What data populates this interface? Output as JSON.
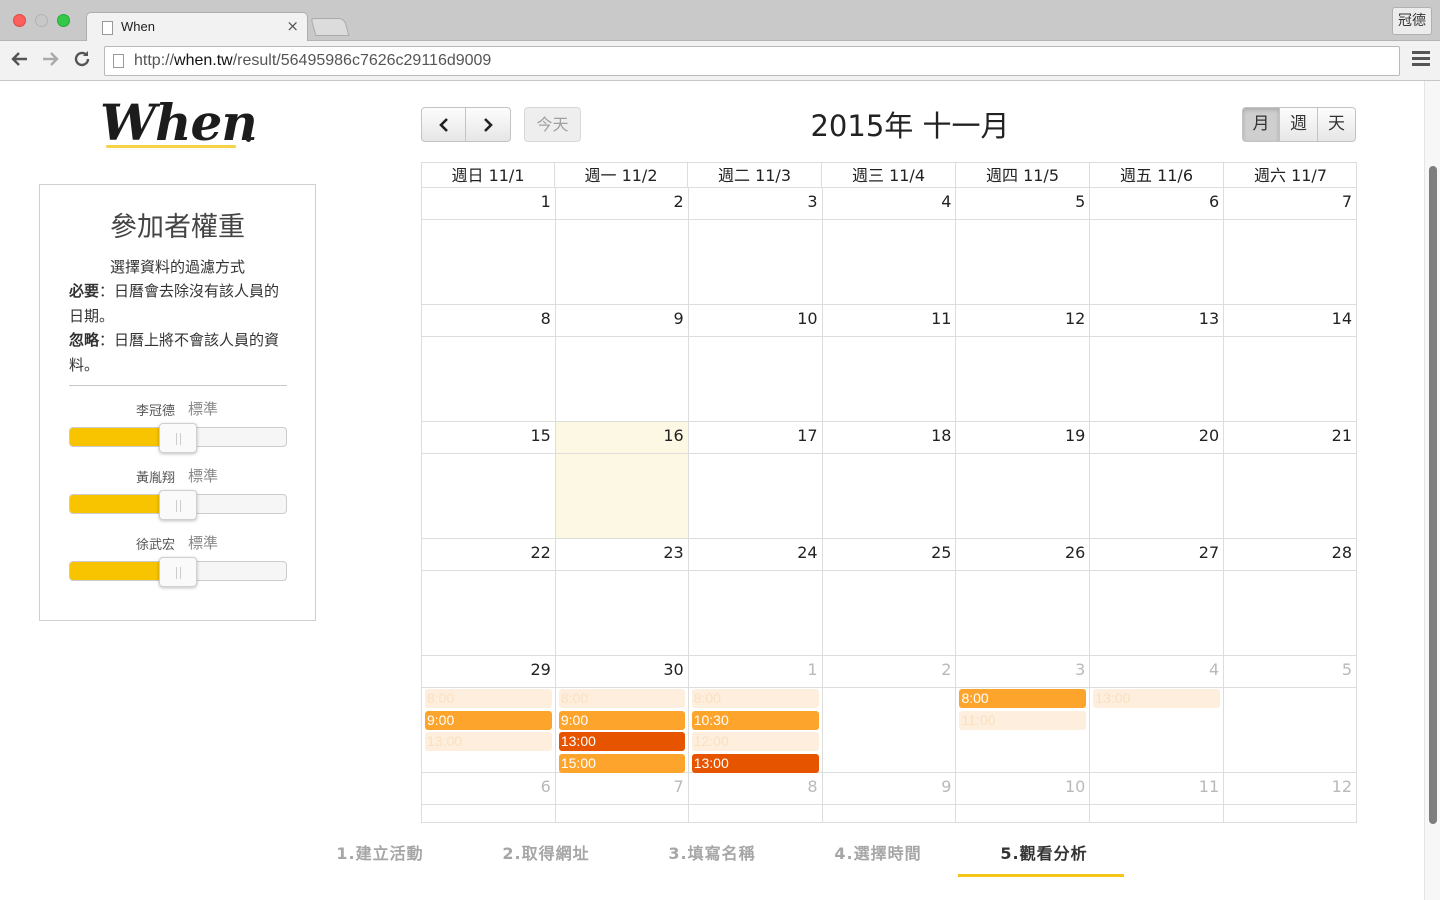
{
  "browser": {
    "tab_title": "When",
    "tab_close": "×",
    "profile": "冠德",
    "url_prefix": "http://",
    "url_host": "when.tw",
    "url_path": "/result/56495986c7626c29116d9009"
  },
  "logo": "When",
  "weights_panel": {
    "title": "參加者權重",
    "subtitle": "選擇資料的過濾方式",
    "required_label": "必要",
    "required_text": "：日曆會去除沒有該人員的日期。",
    "ignore_label": "忽略",
    "ignore_text": "：日曆上將不會該人員的資料。",
    "participants": [
      {
        "name": "李冠德",
        "level_label": "標準",
        "level": 0.5
      },
      {
        "name": "黃胤翔",
        "level_label": "標準",
        "level": 0.5
      },
      {
        "name": "徐武宏",
        "level_label": "標準",
        "level": 0.5
      }
    ]
  },
  "calendar": {
    "prev": "‹",
    "next": "›",
    "today": "今天",
    "title": "2015年 十一月",
    "views": [
      {
        "label": "月",
        "active": true
      },
      {
        "label": "週",
        "active": false
      },
      {
        "label": "天",
        "active": false
      }
    ],
    "day_headers": [
      "週日 11/1",
      "週一 11/2",
      "週二 11/3",
      "週三 11/4",
      "週四 11/5",
      "週五 11/6",
      "週六 11/7"
    ],
    "weeks": [
      [
        {
          "d": "1"
        },
        {
          "d": "2"
        },
        {
          "d": "3"
        },
        {
          "d": "4"
        },
        {
          "d": "5"
        },
        {
          "d": "6"
        },
        {
          "d": "7"
        }
      ],
      [
        {
          "d": "8"
        },
        {
          "d": "9"
        },
        {
          "d": "10"
        },
        {
          "d": "11"
        },
        {
          "d": "12"
        },
        {
          "d": "13"
        },
        {
          "d": "14"
        }
      ],
      [
        {
          "d": "15"
        },
        {
          "d": "16",
          "today": true
        },
        {
          "d": "17"
        },
        {
          "d": "18"
        },
        {
          "d": "19"
        },
        {
          "d": "20"
        },
        {
          "d": "21"
        }
      ],
      [
        {
          "d": "22"
        },
        {
          "d": "23"
        },
        {
          "d": "24"
        },
        {
          "d": "25"
        },
        {
          "d": "26"
        },
        {
          "d": "27"
        },
        {
          "d": "28"
        }
      ],
      [
        {
          "d": "29",
          "events": [
            {
              "t": "8:00",
              "k": "faint"
            },
            {
              "t": "9:00",
              "k": "mid"
            },
            {
              "t": "13:00",
              "k": "faint"
            }
          ]
        },
        {
          "d": "30",
          "events": [
            {
              "t": "8:00",
              "k": "faint"
            },
            {
              "t": "9:00",
              "k": "mid"
            },
            {
              "t": "13:00",
              "k": "strong"
            },
            {
              "t": "15:00",
              "k": "mid"
            }
          ]
        },
        {
          "d": "1",
          "other": true,
          "events": [
            {
              "t": "8:00",
              "k": "faint"
            },
            {
              "t": "10:30",
              "k": "mid"
            },
            {
              "t": "12:00",
              "k": "faint"
            },
            {
              "t": "13:00",
              "k": "strong"
            }
          ]
        },
        {
          "d": "2",
          "other": true,
          "events": []
        },
        {
          "d": "3",
          "other": true,
          "events": [
            {
              "t": "8:00",
              "k": "mid"
            },
            {
              "t": "11:00",
              "k": "faint"
            }
          ]
        },
        {
          "d": "4",
          "other": true,
          "events": [
            {
              "t": "13:00",
              "k": "faint"
            }
          ]
        },
        {
          "d": "5",
          "other": true,
          "events": []
        }
      ],
      [
        {
          "d": "6",
          "other": true
        },
        {
          "d": "7",
          "other": true
        },
        {
          "d": "8",
          "other": true
        },
        {
          "d": "9",
          "other": true
        },
        {
          "d": "10",
          "other": true
        },
        {
          "d": "11",
          "other": true
        },
        {
          "d": "12",
          "other": true
        }
      ]
    ]
  },
  "steps": [
    {
      "label": "1.建立活動",
      "active": false
    },
    {
      "label": "2.取得網址",
      "active": false
    },
    {
      "label": "3.填寫名稱",
      "active": false
    },
    {
      "label": "4.選擇時間",
      "active": false
    },
    {
      "label": "5.觀看分析",
      "active": true
    }
  ],
  "colors": {
    "accent": "#f5c518",
    "event_mid": "#fda42d",
    "event_strong": "#e75400",
    "event_faint": "#fdeede",
    "today_bg": "#fcf8e3"
  }
}
